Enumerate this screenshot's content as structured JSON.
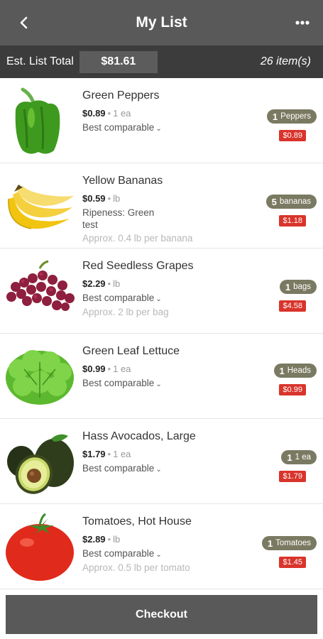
{
  "header": {
    "title": "My List",
    "back_icon": "back-chevron-icon",
    "more_icon": "more-dots-icon"
  },
  "summary": {
    "total_label": "Est. List Total",
    "total_value": "$81.61",
    "item_count": "26 item(s)"
  },
  "items": [
    {
      "name": "Green Peppers",
      "price": "$0.89",
      "unit": "1 ea",
      "line1": "Best comparable",
      "qty": "1",
      "qty_unit": "Peppers",
      "line_total": "$0.89"
    },
    {
      "name": "Yellow Bananas",
      "price": "$0.59",
      "unit": "lb",
      "line1": "Ripeness: Green",
      "line2": "test",
      "approx": "Approx. 0.4 lb per banana",
      "qty": "5",
      "qty_unit": "bananas",
      "line_total": "$1.18"
    },
    {
      "name": "Red Seedless Grapes",
      "price": "$2.29",
      "unit": "lb",
      "line1": "Best comparable",
      "approx": "Approx. 2 lb per bag",
      "qty": "1",
      "qty_unit": "bags",
      "line_total": "$4.58"
    },
    {
      "name": "Green Leaf Lettuce",
      "price": "$0.99",
      "unit": "1 ea",
      "line1": "Best comparable",
      "qty": "1",
      "qty_unit": "Heads",
      "line_total": "$0.99"
    },
    {
      "name": "Hass Avocados, Large",
      "price": "$1.79",
      "unit": "1 ea",
      "line1": "Best comparable",
      "qty": "1",
      "qty_unit": "1 ea",
      "line_total": "$1.79"
    },
    {
      "name": "Tomatoes, Hot House",
      "price": "$2.89",
      "unit": "lb",
      "line1": "Best comparable",
      "approx": "Approx. 0.5 lb per tomato",
      "qty": "1",
      "qty_unit": "Tomatoes",
      "line_total": "$1.45"
    }
  ],
  "checkout": {
    "label": "Checkout"
  },
  "colors": {
    "header": "#595959",
    "total_bar": "#3c3c3c",
    "qty_badge": "#7a7a62",
    "price_tag": "#d9342b"
  }
}
